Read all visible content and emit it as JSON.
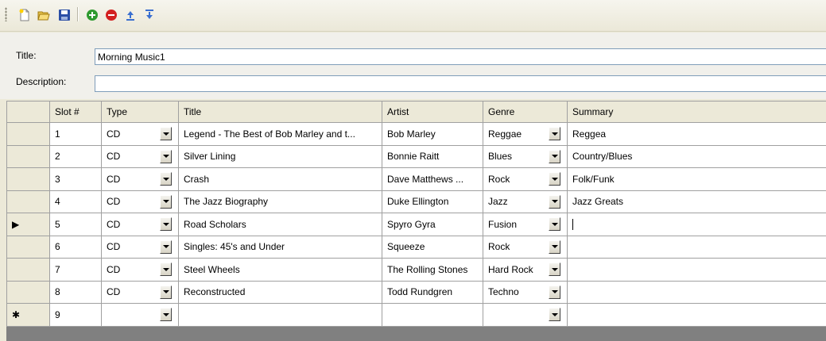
{
  "form": {
    "title_label": "Title:",
    "title_value": "Morning Music1",
    "description_label": "Description:",
    "description_value": ""
  },
  "toolbar": {
    "buttons": [
      "new-file-icon",
      "open-folder-icon",
      "save-icon",
      "add-icon",
      "remove-icon",
      "move-up-icon",
      "move-down-icon"
    ]
  },
  "grid": {
    "columns": [
      "Slot #",
      "Type",
      "Title",
      "Artist",
      "Genre",
      "Summary"
    ],
    "rows": [
      {
        "slot": "1",
        "type": "CD",
        "title": "Legend - The Best of Bob Marley and t...",
        "artist": "Bob Marley",
        "genre": "Reggae",
        "summary": "Reggea",
        "indicator": ""
      },
      {
        "slot": "2",
        "type": "CD",
        "title": "Silver Lining",
        "artist": "Bonnie Raitt",
        "genre": "Blues",
        "summary": "Country/Blues",
        "indicator": ""
      },
      {
        "slot": "3",
        "type": "CD",
        "title": "Crash",
        "artist": "Dave Matthews ...",
        "genre": "Rock",
        "summary": "Folk/Funk",
        "indicator": ""
      },
      {
        "slot": "4",
        "type": "CD",
        "title": "The Jazz Biography",
        "artist": "Duke Ellington",
        "genre": "Jazz",
        "summary": "Jazz Greats",
        "indicator": ""
      },
      {
        "slot": "5",
        "type": "CD",
        "title": "Road Scholars",
        "artist": "Spyro Gyra",
        "genre": "Fusion",
        "summary": "",
        "indicator": "▶"
      },
      {
        "slot": "6",
        "type": "CD",
        "title": "Singles: 45's and Under",
        "artist": "Squeeze",
        "genre": "Rock",
        "summary": "",
        "indicator": ""
      },
      {
        "slot": "7",
        "type": "CD",
        "title": "Steel Wheels",
        "artist": "The Rolling Stones",
        "genre": "Hard Rock",
        "summary": "",
        "indicator": ""
      },
      {
        "slot": "8",
        "type": "CD",
        "title": "Reconstructed",
        "artist": "Todd Rundgren",
        "genre": "Techno",
        "summary": "",
        "indicator": ""
      },
      {
        "slot": "9",
        "type": "",
        "title": "",
        "artist": "",
        "genre": "",
        "summary": "",
        "indicator": "✱"
      }
    ]
  }
}
